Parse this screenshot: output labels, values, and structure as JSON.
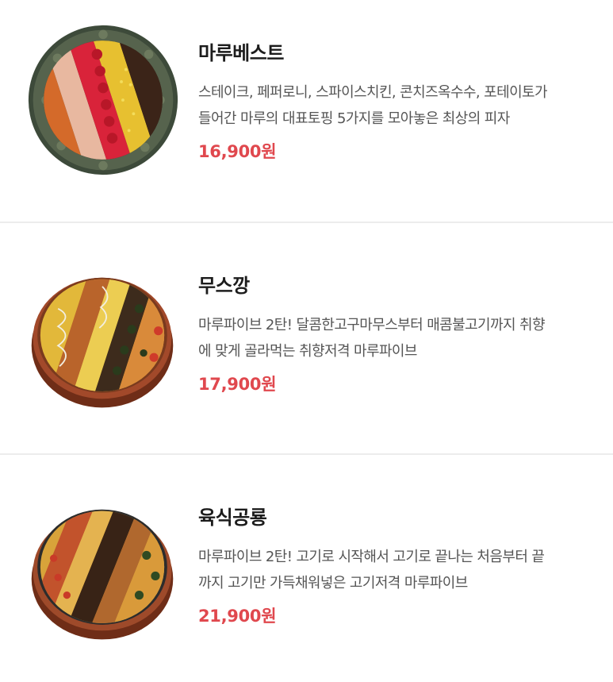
{
  "menu": {
    "items": [
      {
        "name": "마루베스트",
        "desc_line1": "스테이크, 페퍼로니, 스파이스치킨, 콘치즈옥수수, 포테이토가",
        "desc_line2": "들어간 마루의 대표토핑 5가지를 모아놓은 최상의 피자",
        "price": "16,900원",
        "image": "pizza-image"
      },
      {
        "name": "무스깡",
        "desc_line1": "마루파이브 2탄! 달콤한고구마무스부터 매콤불고기까지 취향",
        "desc_line2": "에 맞게 골라먹는 취향저격 마루파이브",
        "price": "17,900원",
        "image": "pizza-image"
      },
      {
        "name": "육식공룡",
        "desc_line1": "마루파이브 2탄! 고기로 시작해서 고기로 끝나는 처음부터 끝",
        "desc_line2": "까지 고기만 가득채워넣은 고기저격 마루파이브",
        "price": "21,900원",
        "image": "pizza-image"
      }
    ]
  },
  "colors": {
    "price": "#e0484e",
    "title": "#1c1c1c",
    "description": "#555555",
    "divider": "#ececec"
  }
}
